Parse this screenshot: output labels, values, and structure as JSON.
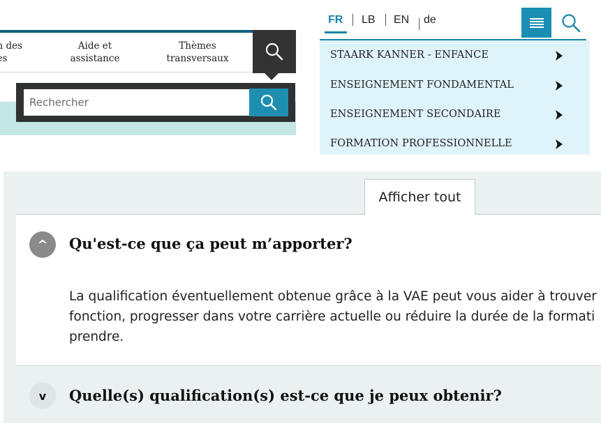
{
  "main_nav": {
    "items": [
      {
        "label": "n des\nes"
      },
      {
        "label": "Aide et\nassistance"
      },
      {
        "label": "Thèmes\ntransversaux"
      }
    ],
    "search_icon": "search-icon"
  },
  "search": {
    "placeholder": "Rechercher",
    "submit_icon": "search-icon"
  },
  "side_menu": {
    "languages": [
      "FR",
      "LB",
      "EN",
      "de"
    ],
    "active_language": "FR",
    "items": [
      {
        "label": "STAARK KANNER - ENFANCE"
      },
      {
        "label": "ENSEIGNEMENT FONDAMENTAL"
      },
      {
        "label": "ENSEIGNEMENT SECONDAIRE"
      },
      {
        "label": "FORMATION PROFESSIONNELLE"
      }
    ]
  },
  "accordion": {
    "show_all_label": "Afficher tout",
    "items": [
      {
        "toggle": "^",
        "title": "Qu'est-ce que ça peut m’apporter?",
        "expanded": true,
        "body_lines": [
          "La qualification éventuellement obtenue grâce à la VAE peut vous aider à trouver",
          "fonction, progresser dans votre carrière actuelle ou réduire la durée de la formati",
          "prendre."
        ]
      },
      {
        "toggle": "v",
        "title": "Quelle(s) qualification(s) est-ce que je peux obtenir?",
        "expanded": false
      }
    ]
  },
  "colors": {
    "accent": "#1a86a8",
    "dark": "#333333",
    "menu_bg": "#dff3fb",
    "teal_strip": "#c3e7e3",
    "accordion_bg": "#ebf1f1"
  }
}
